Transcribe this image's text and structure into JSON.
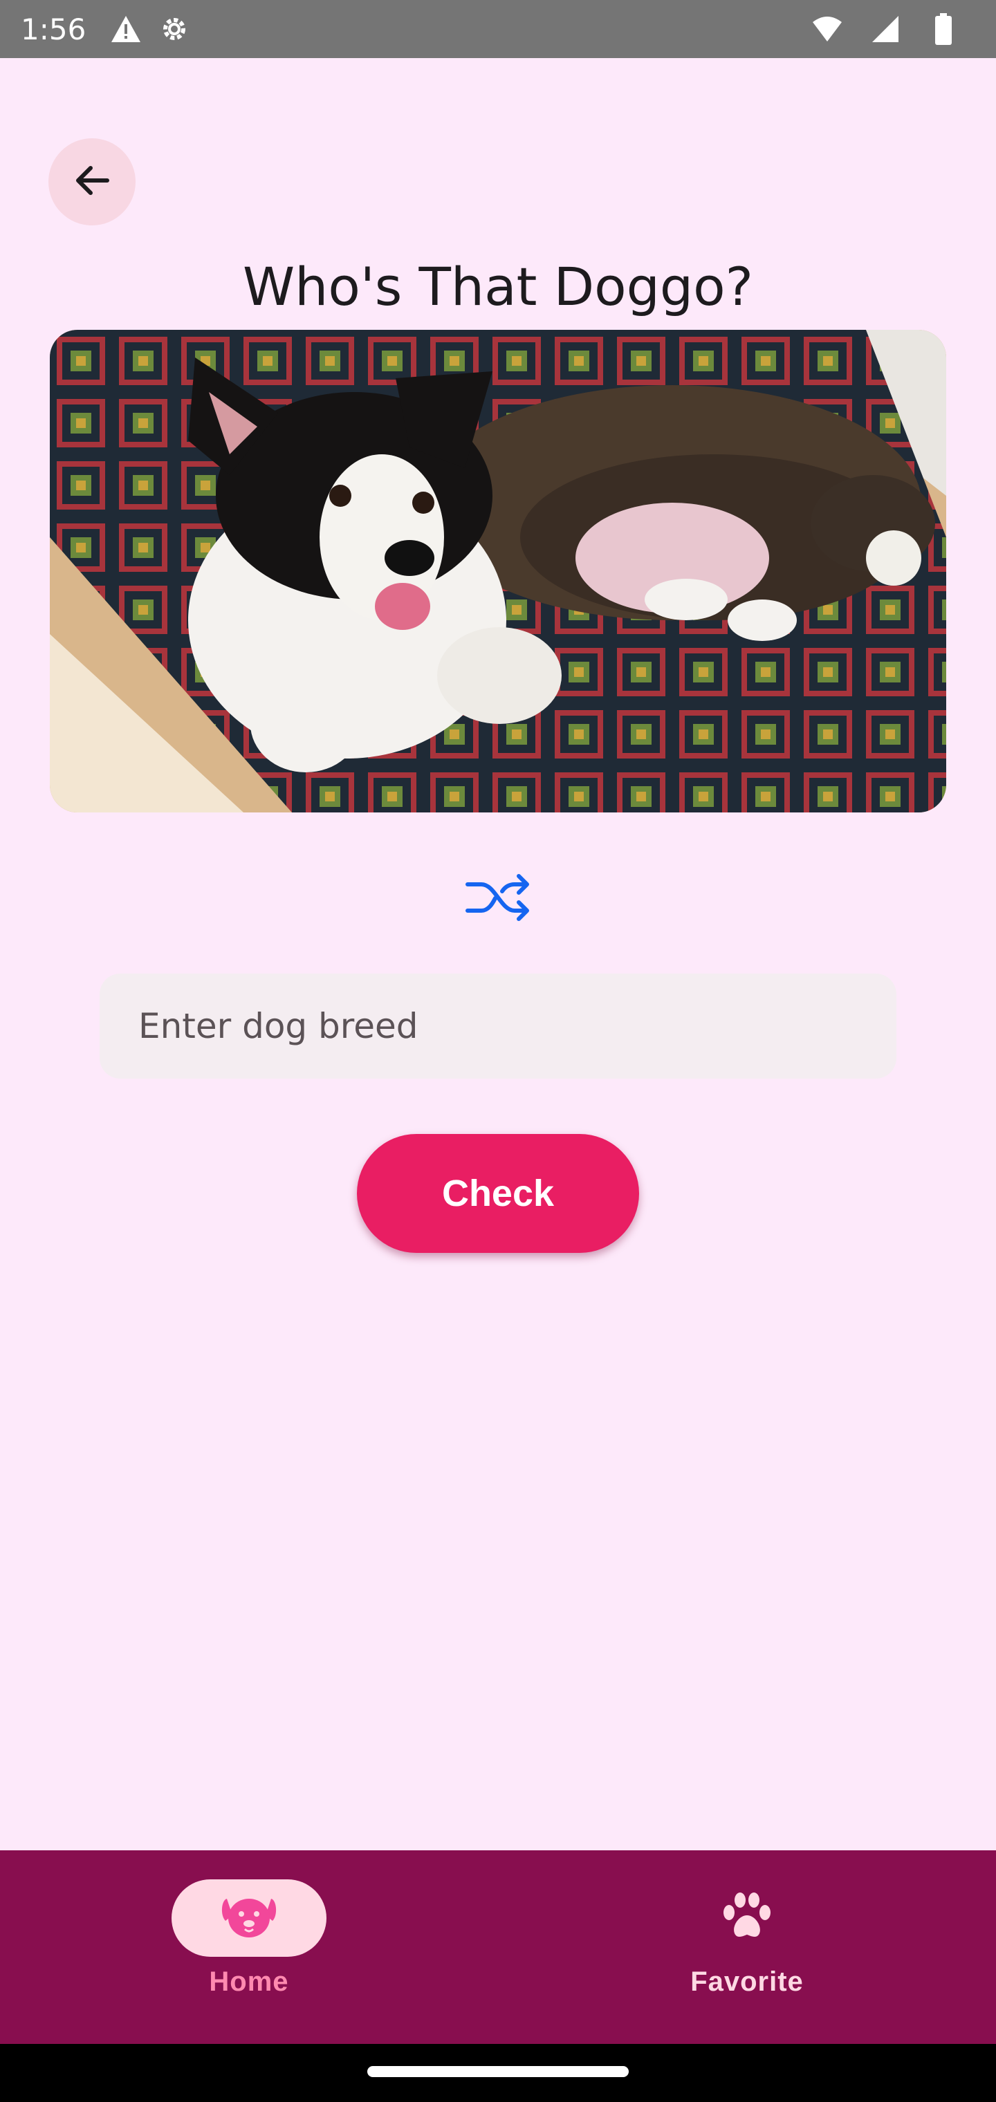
{
  "status_bar": {
    "time": "1:56",
    "icons": [
      "alert-icon",
      "settings-icon",
      "wifi-icon",
      "signal-icon",
      "battery-icon"
    ]
  },
  "header": {
    "back_icon": "arrow-back-icon",
    "title": "Who's That Doggo?"
  },
  "main": {
    "photo_subject": "dog-photo",
    "shuffle_icon": "shuffle-icon",
    "breed_input": {
      "placeholder": "Enter dog breed",
      "value": ""
    },
    "check_label": "Check"
  },
  "bottom_nav": {
    "items": [
      {
        "label": "Home",
        "icon": "dog-face-icon",
        "active": true
      },
      {
        "label": "Favorite",
        "icon": "paw-icon",
        "active": false
      }
    ]
  },
  "colors": {
    "background": "#FDE9FA",
    "accent": "#E91E63",
    "nav_background": "#880E4F",
    "shuffle": "#1565F0"
  }
}
